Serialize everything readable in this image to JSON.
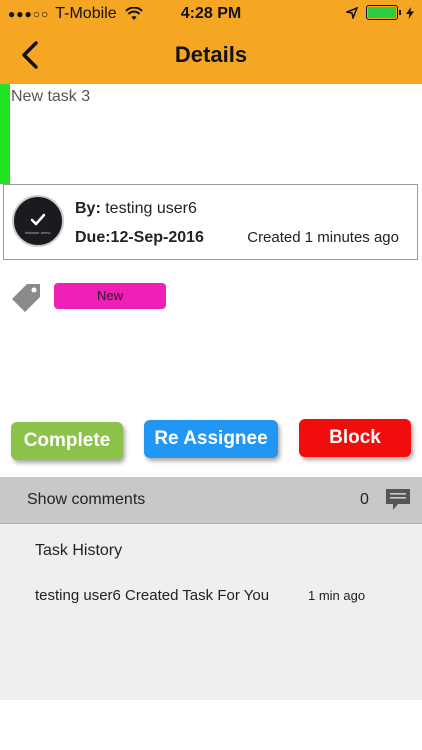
{
  "status_bar": {
    "carrier": "T-Mobile",
    "signal_dots": "●●●○○",
    "time": "4:28 PM"
  },
  "header": {
    "title": "Details",
    "background": "#F5A623"
  },
  "task": {
    "title": "New task 3",
    "priority_color": "#22E322"
  },
  "info": {
    "by_prefix": "By:",
    "by_name": "testing user6",
    "due": "Due:12-Sep-2016",
    "created": "Created 1 minutes ago",
    "avatar_caption": "testuser demo"
  },
  "tag": {
    "status_label": "New",
    "color": "#EE1FB5"
  },
  "actions": {
    "complete_label": "Complete",
    "reassign_label": "Re Assignee",
    "block_label": "Block"
  },
  "comments": {
    "label": "Show comments",
    "count": "0"
  },
  "history": {
    "title": "Task History",
    "items": [
      {
        "text": "testing user6 Created Task For You",
        "time": "1 min ago"
      }
    ]
  }
}
